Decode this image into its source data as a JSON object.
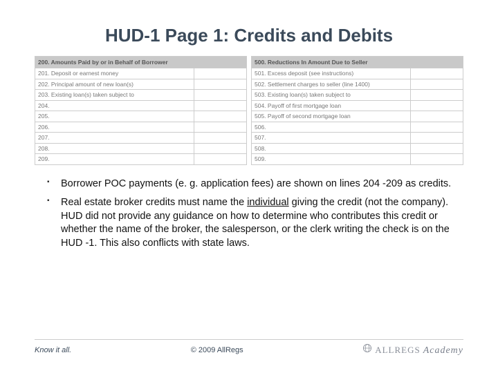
{
  "title": "HUD-1 Page 1: Credits and Debits",
  "left_table": {
    "header": "200. Amounts Paid by or in Behalf of Borrower",
    "rows": [
      "201. Deposit or earnest money",
      "202. Principal amount of new loan(s)",
      "203. Existing loan(s) taken subject to",
      "204.",
      "205.",
      "206.",
      "207.",
      "208.",
      "209."
    ]
  },
  "right_table": {
    "header": "500. Reductions In Amount Due to Seller",
    "rows": [
      "501. Excess deposit (see instructions)",
      "502. Settlement charges to seller (line 1400)",
      "503. Existing loan(s) taken subject to",
      "504. Payoff of first mortgage loan",
      "505. Payoff of second mortgage loan",
      "506.",
      "507.",
      "508.",
      "509."
    ]
  },
  "bullets": [
    {
      "pre": "Borrower POC payments (e. g. application fees) are shown on lines 204 -209 as credits.",
      "underline": "",
      "post": ""
    },
    {
      "pre": "Real estate broker credits must name the ",
      "underline": "individual",
      "post": " giving the credit (not the company). HUD did not provide any guidance on how to determine who contributes this credit or whether the name of the broker, the salesperson, or the clerk writing the check is on the HUD -1. This also conflicts with state laws."
    }
  ],
  "footer": {
    "tagline": "Know it all.",
    "copyright": "© 2009 AllRegs",
    "logo_main": "ALLREGS",
    "logo_sub": "Academy"
  }
}
